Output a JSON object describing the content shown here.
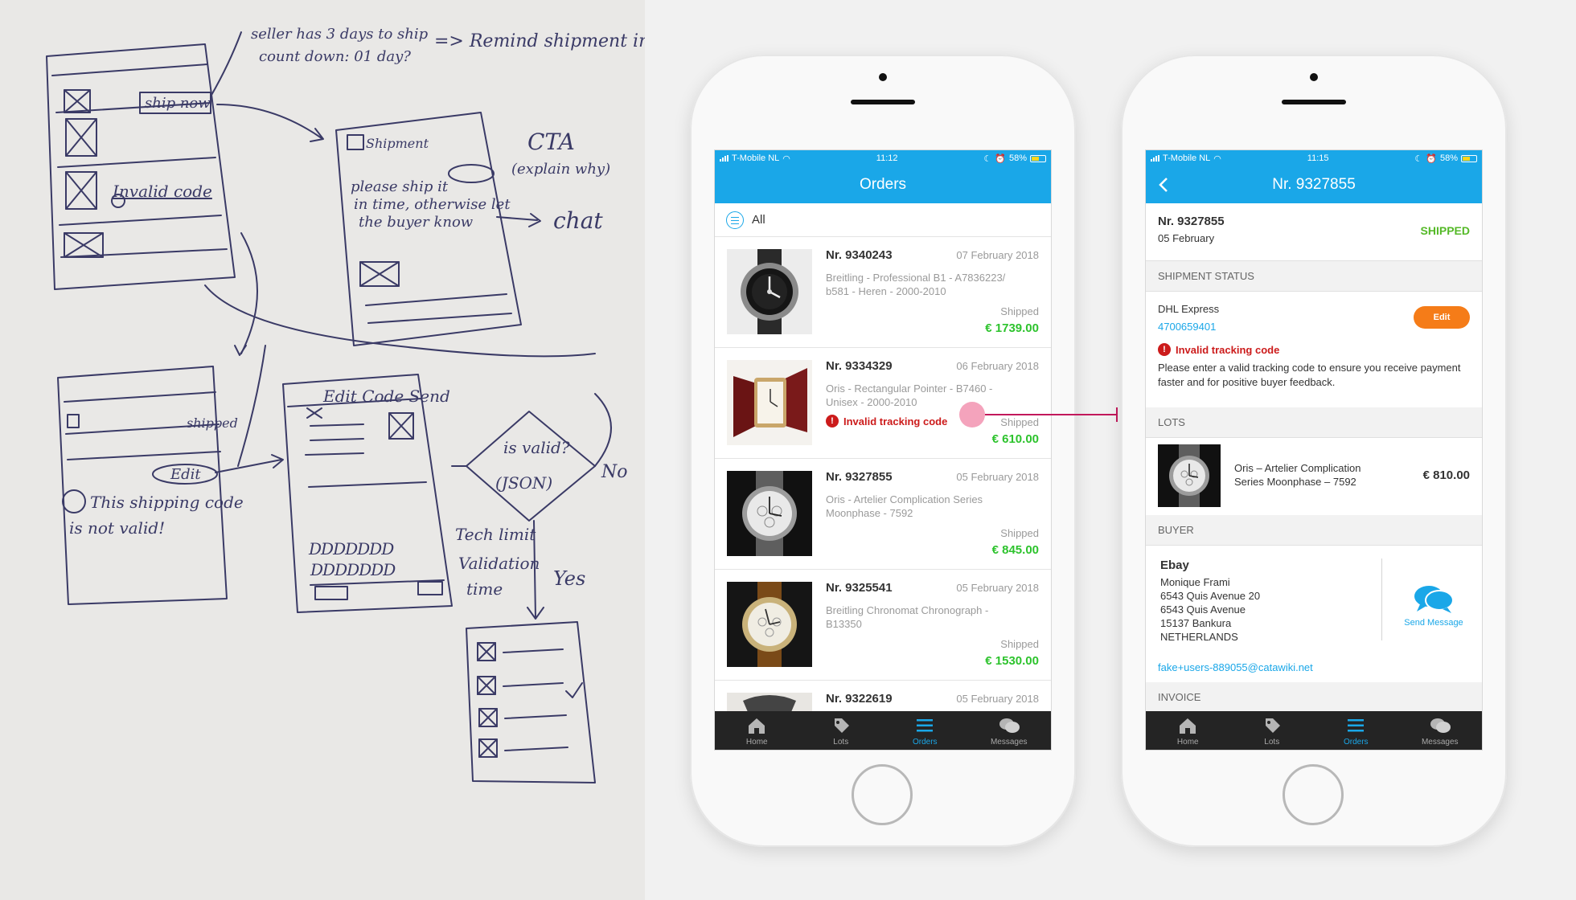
{
  "sketch": {
    "notes": {
      "seller": "seller has 3 days to ship",
      "countdown": "count down: 01 day?",
      "remind": "=> Remind shipment in time.",
      "ship_now": "ship now",
      "invalid_code": "Invalid code",
      "cta": "CTA",
      "explain": "(explain why)",
      "shipment": "Shipment",
      "please_ship": "please ship it",
      "in_time": "in time, otherwise let",
      "buyer_know": "the buyer know",
      "chat": "chat",
      "shipped": "shipped",
      "edit": "Edit",
      "this_code": "This shipping code",
      "not_valid": "is not valid!",
      "edit_code": "Edit Code Send",
      "is_valid": "is valid?",
      "json": "(JSON)",
      "no": "No",
      "tech_limit": "Tech limit",
      "validation": "Validation",
      "time": "time",
      "yes": "Yes"
    }
  },
  "status_bar_1": {
    "carrier": "T-Mobile NL",
    "time": "11:12",
    "battery": "58%"
  },
  "status_bar_2": {
    "carrier": "T-Mobile NL",
    "time": "11:15",
    "battery": "58%"
  },
  "orders_screen": {
    "title": "Orders",
    "filter": "All",
    "orders": [
      {
        "number": "Nr. 9340243",
        "date": "07 February 2018",
        "desc": "Breitling - Professional B1 - A7836223/ b581 - Heren - 2000-2010",
        "status": "Shipped",
        "price": "€ 1739.00"
      },
      {
        "number": "Nr. 9334329",
        "date": "06 February 2018",
        "desc": "Oris - Rectangular Pointer - B7460 - Unisex - 2000-2010",
        "status": "Shipped",
        "price": "€ 610.00",
        "warning": "Invalid tracking code"
      },
      {
        "number": "Nr. 9327855",
        "date": "05 February 2018",
        "desc": "Oris - Artelier Complication Series Moonphase - 7592",
        "status": "Shipped",
        "price": "€ 845.00"
      },
      {
        "number": "Nr. 9325541",
        "date": "05 February 2018",
        "desc": "Breitling Chronomat Chronograph - B13350",
        "status": "Shipped",
        "price": "€ 1530.00"
      },
      {
        "number": "Nr. 9322619",
        "date": "05 February 2018"
      }
    ]
  },
  "tabs": {
    "home": "Home",
    "lots": "Lots",
    "orders": "Orders",
    "messages": "Messages"
  },
  "detail_screen": {
    "title": "Nr. 9327855",
    "number": "Nr. 9327855",
    "date": "05 February",
    "status": "SHIPPED",
    "shipment_heading": "SHIPMENT STATUS",
    "carrier": "DHL Express",
    "tracking_code": "4700659401",
    "edit_label": "Edit",
    "warning": "Invalid tracking code",
    "help": "Please enter a valid tracking code to ensure you receive payment faster and for positive buyer feedback.",
    "lots_heading": "LOTS",
    "lot_name": "Oris – Artelier Complication Series Moonphase – 7592",
    "lot_price": "€ 810.00",
    "buyer_heading": "BUYER",
    "buyer_name": "Ebay",
    "buyer_lines": [
      "Monique Frami",
      "6543 Quis Avenue 20",
      "6543 Quis Avenue",
      "15137 Bankura",
      "NETHERLANDS"
    ],
    "send_message": "Send Message",
    "email": "fake+users-889055@catawiki.net",
    "invoice_heading": "INVOICE"
  },
  "colors": {
    "brand": "#1aa7e8",
    "price": "#2dc32d",
    "shipped": "#55b928",
    "error": "#cc1b1b",
    "edit": "#f57c18",
    "annotation": "#c2185b"
  }
}
